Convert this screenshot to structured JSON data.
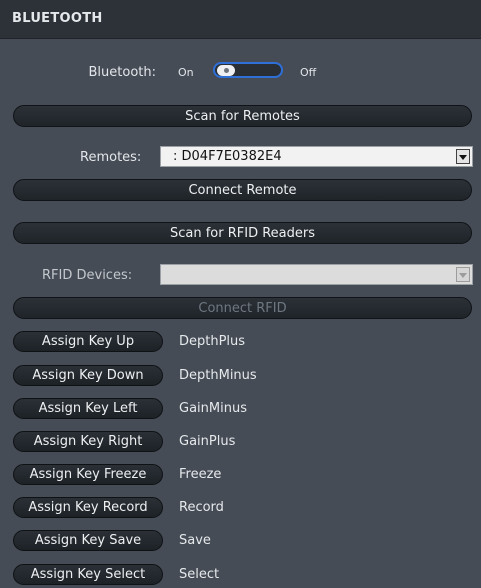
{
  "header": {
    "title": "BLUETOOTH"
  },
  "bluetooth": {
    "label": "Bluetooth:",
    "on_label": "On",
    "off_label": "Off",
    "state": "off"
  },
  "scan_remotes_label": "Scan for Remotes",
  "remotes": {
    "label": "Remotes:",
    "selected": ": D04F7E0382E4"
  },
  "connect_remote_label": "Connect Remote",
  "scan_rfid_label": "Scan for RFID Readers",
  "rfid": {
    "label": "RFID Devices:",
    "selected": ""
  },
  "connect_rfid_label": "Connect RFID",
  "key_assignments": [
    {
      "button": "Assign Key Up",
      "value": "DepthPlus"
    },
    {
      "button": "Assign Key Down",
      "value": "DepthMinus"
    },
    {
      "button": "Assign Key Left",
      "value": "GainMinus"
    },
    {
      "button": "Assign Key Right",
      "value": "GainPlus"
    },
    {
      "button": "Assign Key Freeze",
      "value": "Freeze"
    },
    {
      "button": "Assign Key Record",
      "value": "Record"
    },
    {
      "button": "Assign Key Save",
      "value": "Save"
    },
    {
      "button": "Assign Key Select",
      "value": "Select"
    }
  ],
  "colors": {
    "accent": "#2f6fd8",
    "background": "#454c55",
    "header": "#2c3238"
  }
}
